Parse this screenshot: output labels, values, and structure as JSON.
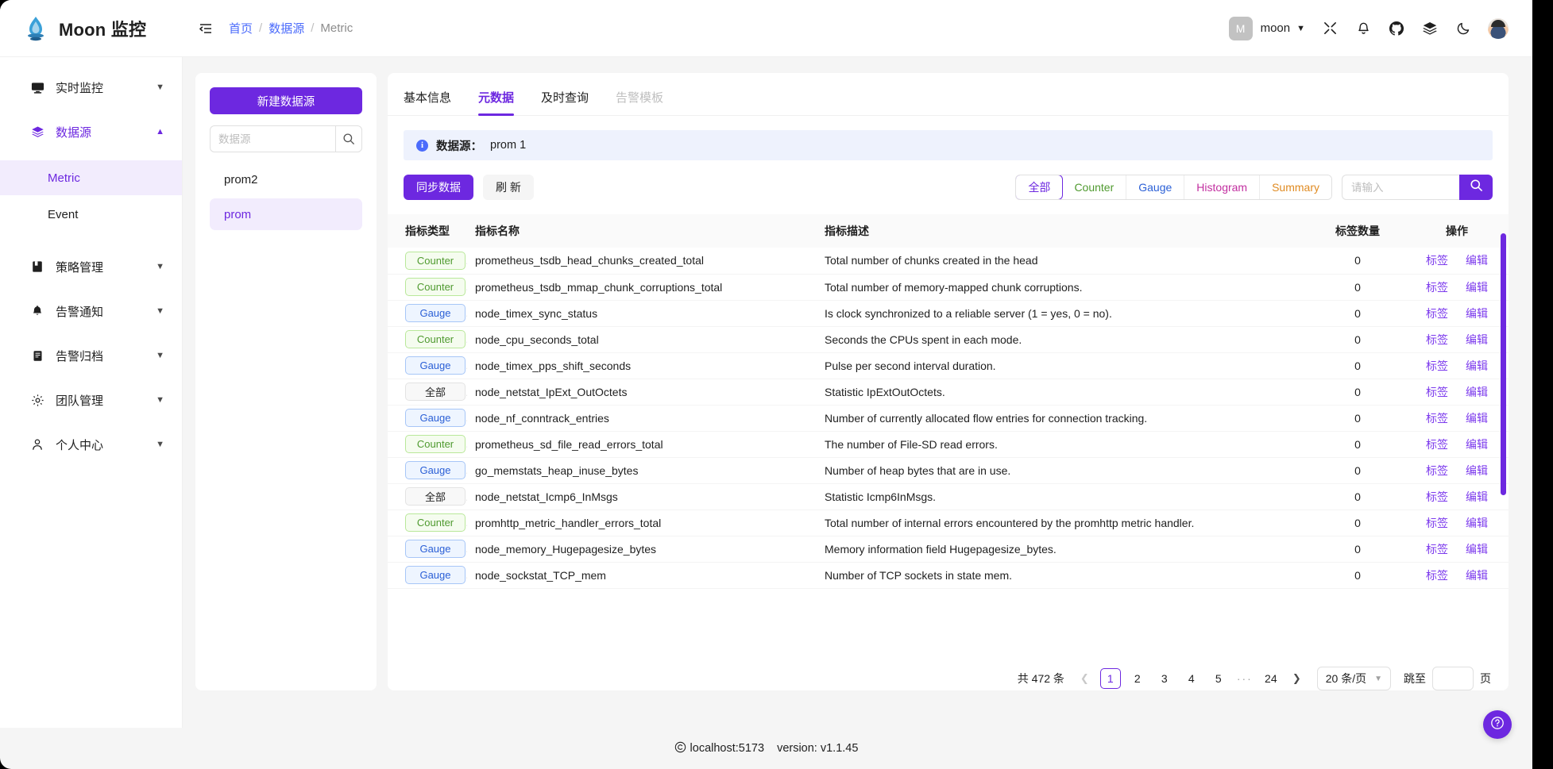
{
  "brand": {
    "title": "Moon 监控",
    "logo_icon": "flame-logo-icon"
  },
  "header": {
    "collapse_icon": "menu-collapse-icon",
    "breadcrumb": [
      {
        "label": "首页",
        "type": "link"
      },
      {
        "label": "数据源",
        "type": "link"
      },
      {
        "label": "Metric",
        "type": "current"
      }
    ],
    "separator": "/",
    "avatar_letter": "M",
    "user_name": "moon",
    "tools": [
      {
        "name": "fullscreen-icon"
      },
      {
        "name": "bell-icon"
      },
      {
        "name": "github-icon"
      },
      {
        "name": "layers-icon"
      },
      {
        "name": "moon-theme-icon"
      }
    ]
  },
  "sidebar": {
    "items": [
      {
        "label": "实时监控",
        "icon": "monitor-icon",
        "expanded": false,
        "active": false
      },
      {
        "label": "数据源",
        "icon": "layers-icon",
        "expanded": true,
        "active": true
      },
      {
        "label": "策略管理",
        "icon": "book-icon",
        "expanded": false,
        "active": false
      },
      {
        "label": "告警通知",
        "icon": "bell-icon",
        "expanded": false,
        "active": false
      },
      {
        "label": "告警归档",
        "icon": "archive-icon",
        "expanded": false,
        "active": false
      },
      {
        "label": "团队管理",
        "icon": "gear-icon",
        "expanded": false,
        "active": false
      },
      {
        "label": "个人中心",
        "icon": "user-icon",
        "expanded": false,
        "active": false
      }
    ],
    "sub_items": [
      {
        "label": "Metric",
        "selected": true
      },
      {
        "label": "Event",
        "selected": false
      }
    ]
  },
  "datasource_panel": {
    "create_label": "新建数据源",
    "search_placeholder": "数据源",
    "search_value": "",
    "search_icon": "search-icon",
    "items": [
      {
        "label": "prom2",
        "selected": false
      },
      {
        "label": "prom",
        "selected": true
      }
    ]
  },
  "main": {
    "tabs": [
      {
        "label": "基本信息",
        "active": false,
        "disabled": false
      },
      {
        "label": "元数据",
        "active": true,
        "disabled": false
      },
      {
        "label": "及时查询",
        "active": false,
        "disabled": false
      },
      {
        "label": "告警模板",
        "active": false,
        "disabled": true
      }
    ],
    "alert": {
      "icon": "info-icon",
      "label": "数据源：",
      "value": "prom 1"
    },
    "toolbar": {
      "sync_label": "同步数据",
      "refresh_label": "刷 新",
      "segments": [
        {
          "label": "全部",
          "selected": true,
          "color": "#6d28e0"
        },
        {
          "label": "Counter",
          "selected": false,
          "color": "#4f9a2f"
        },
        {
          "label": "Gauge",
          "selected": false,
          "color": "#2a5fd6"
        },
        {
          "label": "Histogram",
          "selected": false,
          "color": "#c22fa0"
        },
        {
          "label": "Summary",
          "selected": false,
          "color": "#e08b22"
        }
      ],
      "search_placeholder": "请输入",
      "search_value": "",
      "search_icon": "search-icon"
    },
    "table": {
      "columns": [
        "指标类型",
        "指标名称",
        "指标描述",
        "标签数量",
        "操作"
      ],
      "action_labels": {
        "tag": "标签",
        "edit": "编辑"
      },
      "rows": [
        {
          "type": "Counter",
          "type_kind": "counter",
          "name": "prometheus_tsdb_head_chunks_created_total",
          "desc": "Total number of chunks created in the head",
          "tags": "0"
        },
        {
          "type": "Counter",
          "type_kind": "counter",
          "name": "prometheus_tsdb_mmap_chunk_corruptions_total",
          "desc": "Total number of memory-mapped chunk corruptions.",
          "tags": "0"
        },
        {
          "type": "Gauge",
          "type_kind": "gauge",
          "name": "node_timex_sync_status",
          "desc": "Is clock synchronized to a reliable server (1 = yes, 0 = no).",
          "tags": "0"
        },
        {
          "type": "Counter",
          "type_kind": "counter",
          "name": "node_cpu_seconds_total",
          "desc": "Seconds the CPUs spent in each mode.",
          "tags": "0"
        },
        {
          "type": "Gauge",
          "type_kind": "gauge",
          "name": "node_timex_pps_shift_seconds",
          "desc": "Pulse per second interval duration.",
          "tags": "0"
        },
        {
          "type": "全部",
          "type_kind": "all",
          "name": "node_netstat_IpExt_OutOctets",
          "desc": "Statistic IpExtOutOctets.",
          "tags": "0"
        },
        {
          "type": "Gauge",
          "type_kind": "gauge",
          "name": "node_nf_conntrack_entries",
          "desc": "Number of currently allocated flow entries for connection tracking.",
          "tags": "0"
        },
        {
          "type": "Counter",
          "type_kind": "counter",
          "name": "prometheus_sd_file_read_errors_total",
          "desc": "The number of File-SD read errors.",
          "tags": "0"
        },
        {
          "type": "Gauge",
          "type_kind": "gauge",
          "name": "go_memstats_heap_inuse_bytes",
          "desc": "Number of heap bytes that are in use.",
          "tags": "0"
        },
        {
          "type": "全部",
          "type_kind": "all",
          "name": "node_netstat_Icmp6_InMsgs",
          "desc": "Statistic Icmp6InMsgs.",
          "tags": "0"
        },
        {
          "type": "Counter",
          "type_kind": "counter",
          "name": "promhttp_metric_handler_errors_total",
          "desc": "Total number of internal errors encountered by the promhttp metric handler.",
          "tags": "0"
        },
        {
          "type": "Gauge",
          "type_kind": "gauge",
          "name": "node_memory_Hugepagesize_bytes",
          "desc": "Memory information field Hugepagesize_bytes.",
          "tags": "0"
        },
        {
          "type": "Gauge",
          "type_kind": "gauge",
          "name": "node_sockstat_TCP_mem",
          "desc": "Number of TCP sockets in state mem.",
          "tags": "0"
        }
      ]
    },
    "pagination": {
      "total_label": "共 472 条",
      "prev_icon": "chevron-left-icon",
      "next_icon": "chevron-right-icon",
      "pages": [
        "1",
        "2",
        "3",
        "4",
        "5"
      ],
      "current_page": "1",
      "ellipsis": "···",
      "last_page": "24",
      "page_size_label": "20 条/页",
      "jump_label": "跳至",
      "jump_value": "",
      "jump_unit": "页"
    }
  },
  "footer": {
    "host": "localhost:5173",
    "version": "version: v1.1.45",
    "copyright_icon": "copyright-icon"
  },
  "help_fab": {
    "icon": "question-circle-icon"
  }
}
